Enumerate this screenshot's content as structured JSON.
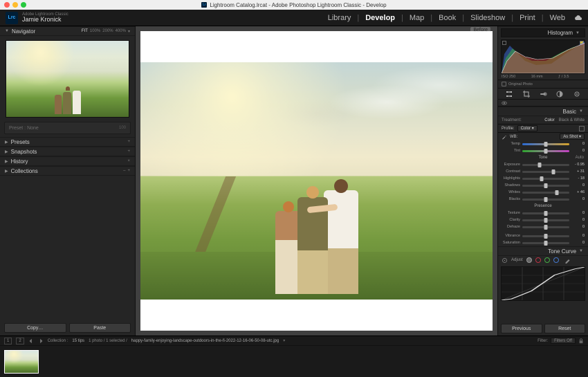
{
  "titlebar": {
    "app_glyph": "Lr",
    "title": "Lightroom Catalog.lrcat - Adobe Photoshop Lightroom Classic - Develop"
  },
  "identity": {
    "lrc": "Lrc",
    "line1": "Adobe Lightroom Classic",
    "line2": "Jamie Kronick"
  },
  "modules": {
    "items": [
      "Library",
      "Develop",
      "Map",
      "Book",
      "Slideshow",
      "Print",
      "Web"
    ],
    "active": "Develop"
  },
  "left": {
    "navigator": {
      "label": "Navigator",
      "fit": "FIT",
      "fill": "100%",
      "z1": "200%",
      "z2": "400%"
    },
    "preset_slot": {
      "label": "Preset : None",
      "end": "100"
    },
    "sections": {
      "presets": "Presets",
      "snapshots": "Snapshots",
      "history": "History",
      "collections": "Collections"
    },
    "copy": "Copy…",
    "paste": "Paste"
  },
  "center": {
    "before_tag": "Before"
  },
  "right": {
    "histogram": {
      "label": "Histogram",
      "iso": "ISO 250",
      "focal": "16 mm",
      "aperture": "ƒ / 3.5",
      "shutter": "",
      "original": "Original Photo"
    },
    "basic": {
      "label": "Basic",
      "treatment": {
        "label": "Treatment:",
        "color": "Color",
        "bw": "Black & White"
      },
      "profile": {
        "label": "Profile:",
        "value": "Color"
      },
      "wb": {
        "label": "WB:",
        "value": "As Shot"
      },
      "temp": {
        "label": "Temp",
        "value": "0",
        "pos": 50
      },
      "tint": {
        "label": "Tint",
        "value": "0",
        "pos": 50
      },
      "tone_hdr": "Tone",
      "auto": "Auto",
      "exposure": {
        "label": "Exposure",
        "value": "- 0.95",
        "pos": 37
      },
      "contrast": {
        "label": "Contrast",
        "value": "+ 31",
        "pos": 66
      },
      "highlights": {
        "label": "Highlights",
        "value": "- 18",
        "pos": 41
      },
      "shadows": {
        "label": "Shadows",
        "value": "0",
        "pos": 50
      },
      "whites": {
        "label": "Whites",
        "value": "+ 46",
        "pos": 73
      },
      "blacks": {
        "label": "Blacks",
        "value": "0",
        "pos": 50
      },
      "presence_hdr": "Presence",
      "texture": {
        "label": "Texture",
        "value": "0",
        "pos": 50
      },
      "clarity": {
        "label": "Clarity",
        "value": "0",
        "pos": 50
      },
      "dehaze": {
        "label": "Dehaze",
        "value": "0",
        "pos": 50
      },
      "vibrance": {
        "label": "Vibrance",
        "value": "0",
        "pos": 50
      },
      "saturation": {
        "label": "Saturation",
        "value": "0",
        "pos": 50
      }
    },
    "tonecurve": {
      "label": "Tone Curve",
      "adjust": "Adjust"
    },
    "previous": "Previous",
    "reset": "Reset"
  },
  "filmstrip": {
    "view1": "1",
    "view2": "2",
    "collection_label": "Collection :",
    "collection_name": "15 tips",
    "count": "1 photo / 1 selected /",
    "filename": "happy-family-enjoying-landscape-outdoors-in-the-fi-2022-12-16-06-50-08-utc.jpg",
    "filter_label": "Filter:",
    "filter_value": "Filters Off"
  }
}
